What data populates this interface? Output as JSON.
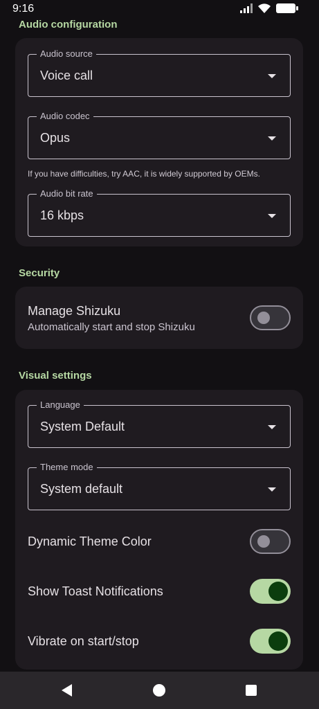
{
  "status_bar": {
    "time": "9:16",
    "icons": [
      "signal-icon",
      "wifi-icon",
      "battery-icon"
    ]
  },
  "audio_configuration": {
    "title": "Audio configuration",
    "source": {
      "label": "Audio source",
      "value": "Voice call"
    },
    "codec": {
      "label": "Audio codec",
      "value": "Opus"
    },
    "helper": "If you have difficulties, try AAC, it is widely supported by OEMs.",
    "bitrate": {
      "label": "Audio bit rate",
      "value": "16 kbps"
    }
  },
  "security": {
    "title": "Security",
    "shizuku": {
      "title": "Manage Shizuku",
      "subtitle": "Automatically start and stop Shizuku",
      "enabled": false
    }
  },
  "visual_settings": {
    "title": "Visual settings",
    "language": {
      "label": "Language",
      "value": "System Default"
    },
    "theme": {
      "label": "Theme mode",
      "value": "System default"
    },
    "dynamic_color": {
      "label": "Dynamic Theme Color",
      "enabled": false
    },
    "toast": {
      "label": "Show Toast Notifications",
      "enabled": true
    },
    "vibrate": {
      "label": "Vibrate on start/stop",
      "enabled": true
    }
  },
  "colors": {
    "background": "#121013",
    "card": "#1f1b20",
    "accent": "#b6d8a3",
    "toggle_on_knob": "#0b3d0d",
    "outline": "#cac4cf"
  },
  "nav_bar": {
    "icons": [
      "back-icon",
      "home-icon",
      "recents-icon"
    ]
  }
}
